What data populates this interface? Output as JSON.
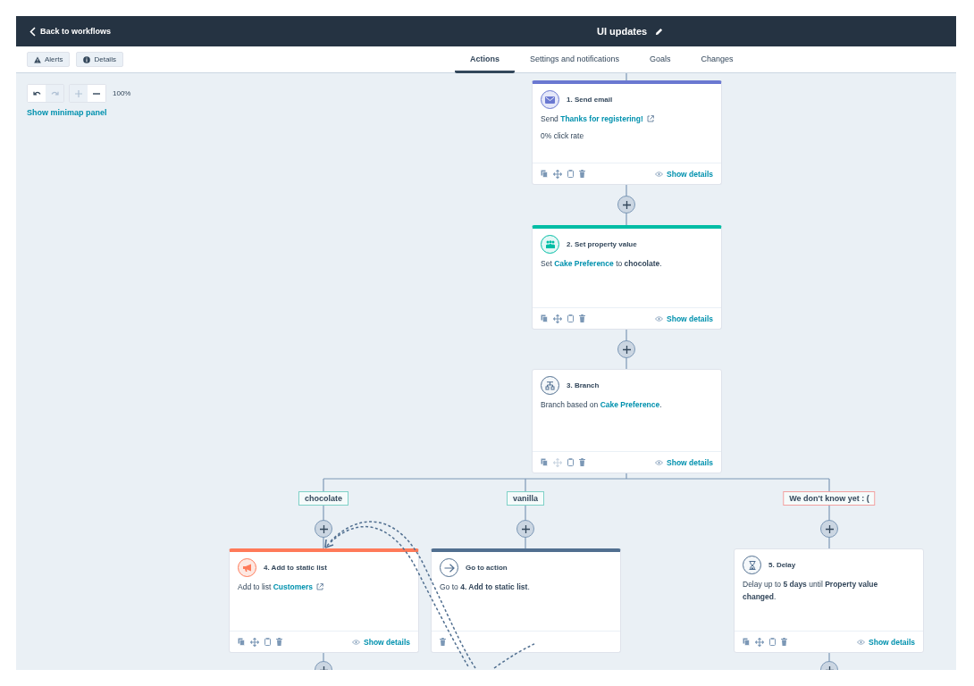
{
  "header": {
    "back_link": "Back to workflows",
    "title": "UI updates"
  },
  "toolbar_buttons": [
    {
      "label": "Alerts",
      "kind": "alert"
    },
    {
      "label": "Details",
      "kind": "info"
    }
  ],
  "tabs": [
    {
      "label": "Actions",
      "selected": true
    },
    {
      "label": "Settings and notifications",
      "selected": false
    },
    {
      "label": "Goals",
      "selected": false
    },
    {
      "label": "Changes",
      "selected": false
    }
  ],
  "canvas_controls": {
    "undo_disabled": false,
    "redo_disabled": true,
    "zoom_in_disabled": true,
    "zoom_out_disabled": false,
    "zoom": "100%",
    "minimap_link": "Show minimap panel"
  },
  "actions": [
    {
      "title": "1. Send email",
      "kind": "email",
      "color": "#6a78d1",
      "body": [
        [
          {
            "kind": "plain",
            "text": "Send "
          },
          {
            "kind": "link",
            "text": "Thanks for registering!",
            "external": true
          }
        ],
        [
          {
            "kind": "plain",
            "text": "0% click rate"
          }
        ]
      ],
      "tools": [
        {
          "kind": "copy",
          "disabled": false
        },
        {
          "kind": "move",
          "disabled": false
        },
        {
          "kind": "clipboard",
          "disabled": false
        },
        {
          "kind": "delete",
          "disabled": false
        }
      ],
      "show_details": "Show details"
    },
    {
      "title": "2. Set property value",
      "kind": "people",
      "color": "#00bda5",
      "body": [
        [
          {
            "kind": "plain",
            "text": "Set "
          },
          {
            "kind": "link",
            "text": "Cake Preference",
            "external": false
          },
          {
            "kind": "plain",
            "text": " to "
          },
          {
            "kind": "bold",
            "text": "chocolate"
          },
          {
            "kind": "plain",
            "text": "."
          }
        ]
      ],
      "tools": [
        {
          "kind": "copy",
          "disabled": false
        },
        {
          "kind": "move",
          "disabled": false
        },
        {
          "kind": "clipboard",
          "disabled": false
        },
        {
          "kind": "delete",
          "disabled": false
        }
      ],
      "show_details": "Show details"
    },
    {
      "title": "3. Branch",
      "kind": "branch",
      "body": [
        [
          {
            "kind": "plain",
            "text": "Branch based on "
          },
          {
            "kind": "link",
            "text": "Cake Preference",
            "external": false
          },
          {
            "kind": "plain",
            "text": "."
          }
        ]
      ],
      "tools": [
        {
          "kind": "copy",
          "disabled": false
        },
        {
          "kind": "move",
          "disabled": true
        },
        {
          "kind": "clipboard",
          "disabled": false
        },
        {
          "kind": "delete",
          "disabled": false
        }
      ],
      "show_details": "Show details"
    },
    {
      "title": "4. Add to static list",
      "kind": "megaphone",
      "color": "#ff7a59",
      "body": [
        [
          {
            "kind": "plain",
            "text": "Add to list "
          },
          {
            "kind": "link",
            "text": "Customers",
            "external": true
          }
        ]
      ],
      "tools": [
        {
          "kind": "copy",
          "disabled": false
        },
        {
          "kind": "move",
          "disabled": false
        },
        {
          "kind": "clipboard",
          "disabled": false
        },
        {
          "kind": "delete",
          "disabled": false
        }
      ],
      "show_details": "Show details"
    },
    {
      "title": "Go to action",
      "kind": "arrow",
      "color": "#516f90",
      "body": [
        [
          {
            "kind": "plain",
            "text": "Go to "
          },
          {
            "kind": "bold",
            "text": "4. Add to static list"
          },
          {
            "kind": "plain",
            "text": "."
          }
        ]
      ],
      "tools": [
        {
          "kind": "delete",
          "disabled": false
        }
      ]
    },
    {
      "title": "5. Delay",
      "kind": "hourglass",
      "body": [
        [
          {
            "kind": "plain",
            "text": "Delay up to "
          },
          {
            "kind": "bold",
            "text": "5 days"
          },
          {
            "kind": "plain",
            "text": " until "
          },
          {
            "kind": "bold",
            "text": "Property value changed"
          },
          {
            "kind": "plain",
            "text": "."
          }
        ]
      ],
      "tools": [
        {
          "kind": "copy",
          "disabled": false
        },
        {
          "kind": "move",
          "disabled": false
        },
        {
          "kind": "clipboard",
          "disabled": false
        },
        {
          "kind": "delete",
          "disabled": false
        }
      ],
      "show_details": "Show details"
    }
  ],
  "branches": [
    {
      "label": "chocolate",
      "color": "#7fd1c7"
    },
    {
      "label": "vanilla",
      "color": "#7fd1c7"
    },
    {
      "label": "We don't know yet : (",
      "color": "#f2a0a0"
    }
  ]
}
